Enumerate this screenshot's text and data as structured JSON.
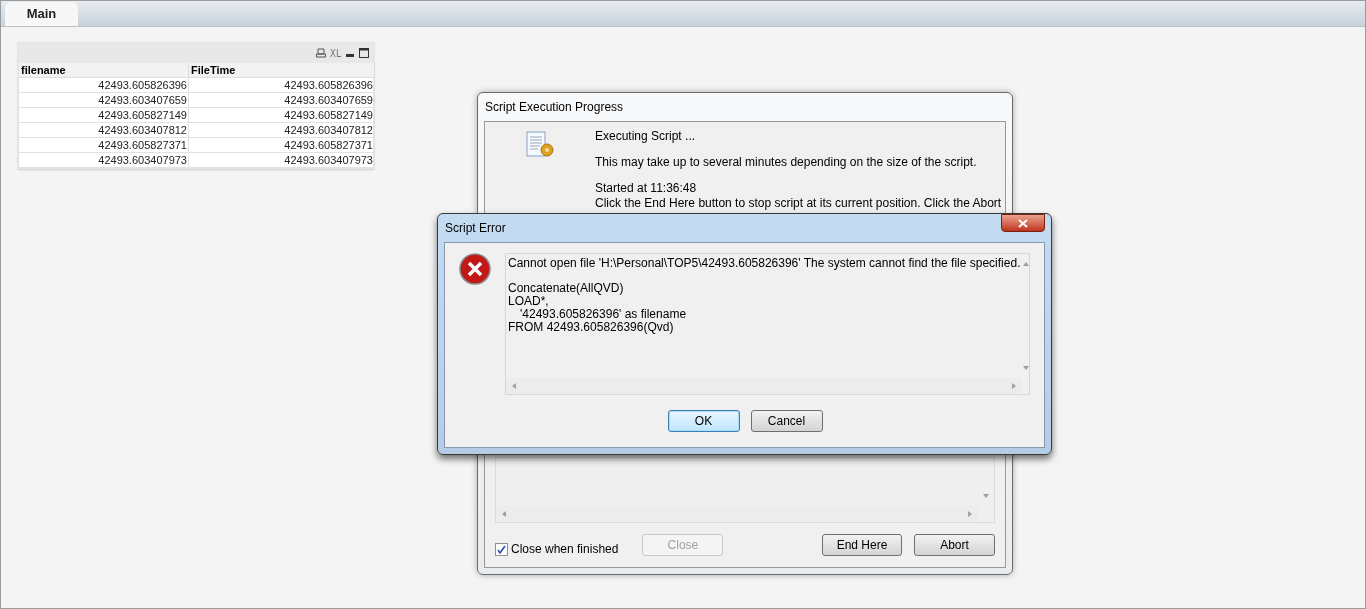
{
  "tabs": [
    {
      "label": "Main",
      "selected": true
    }
  ],
  "table": {
    "toolbar_text": "XL",
    "columns": [
      "filename",
      "FileTime"
    ],
    "rows": [
      [
        "42493.605826396",
        "42493.605826396"
      ],
      [
        "42493.603407659",
        "42493.603407659"
      ],
      [
        "42493.605827149",
        "42493.605827149"
      ],
      [
        "42493.603407812",
        "42493.603407812"
      ],
      [
        "42493.605827371",
        "42493.605827371"
      ],
      [
        "42493.603407973",
        "42493.603407973"
      ]
    ]
  },
  "progress_dialog": {
    "title": "Script Execution Progress",
    "lines": [
      "Executing Script ...",
      "This may take up to several minutes depending on the size of the script.",
      "Started at 11:36:48",
      "Click the End Here button to stop script at its current position. Click the Abort"
    ],
    "checkbox": {
      "label": "Close when finished",
      "checked": true
    },
    "buttons": [
      {
        "label": "Close",
        "disabled": true
      },
      {
        "label": "End Here",
        "disabled": false
      },
      {
        "label": "Abort",
        "disabled": false
      }
    ]
  },
  "error_dialog": {
    "title": "Script Error",
    "message": "Cannot open file 'H:\\Personal\\TOP5\\42493.605826396' The system cannot find the file specified.",
    "script_lines": [
      {
        "text": "Concatenate(AllQVD)",
        "indented": false
      },
      {
        "text": "LOAD*,",
        "indented": false
      },
      {
        "text": "'42493.605826396' as filename",
        "indented": true
      },
      {
        "text": "FROM 42493.605826396(Qvd)",
        "indented": false
      }
    ],
    "buttons": [
      {
        "label": "OK",
        "default": true
      },
      {
        "label": "Cancel",
        "default": false
      }
    ]
  }
}
